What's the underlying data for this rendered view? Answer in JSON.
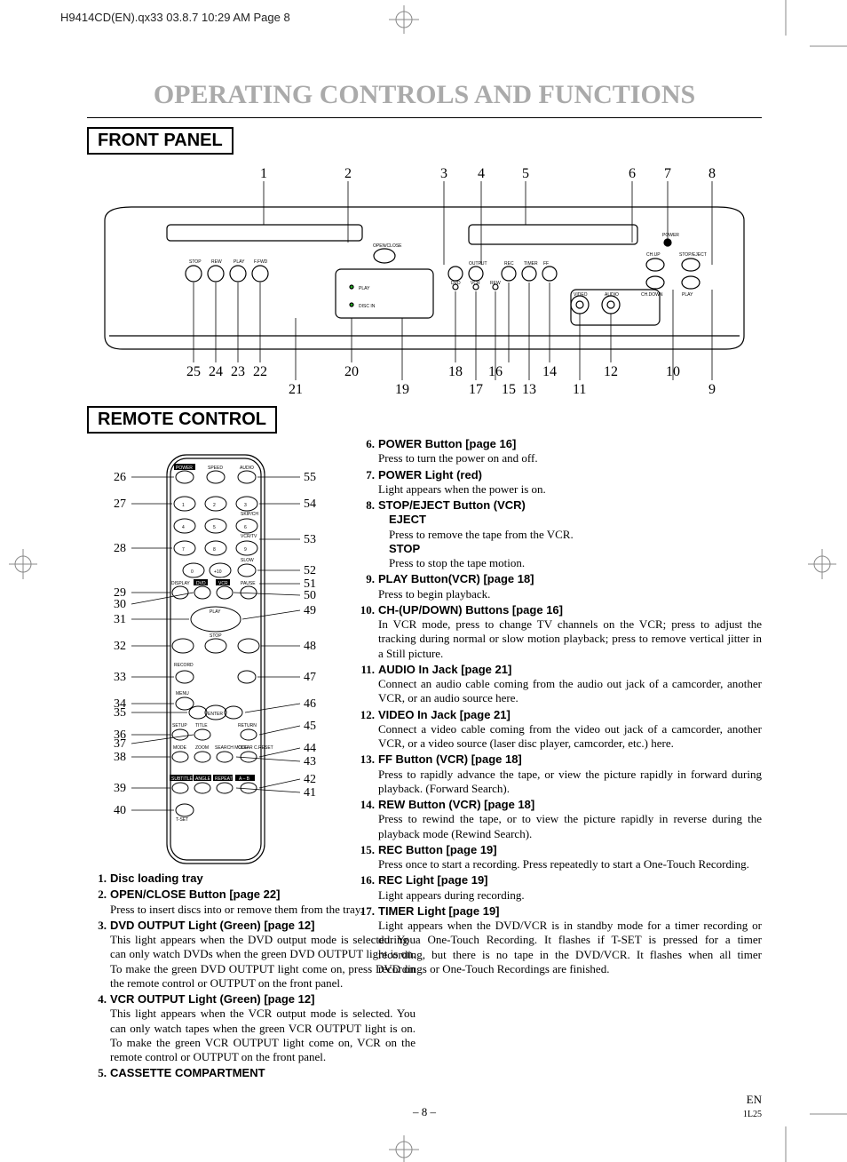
{
  "header_info": "H9414CD(EN).qx33  03.8.7 10:29 AM  Page 8",
  "main_title": "OPERATING CONTROLS AND FUNCTIONS",
  "section_front": "FRONT PANEL",
  "section_remote": "REMOTE CONTROL",
  "front_callouts_top": [
    "1",
    "2",
    "3",
    "4",
    "5",
    "6",
    "7",
    "8"
  ],
  "front_callouts_bottom": [
    "25",
    "24",
    "23",
    "22",
    "20",
    "18",
    "16",
    "14",
    "12",
    "10",
    "21",
    "19",
    "17",
    "15",
    "13",
    "11",
    "9"
  ],
  "remote_left": [
    "26",
    "27",
    "28",
    "29",
    "30",
    "31",
    "32",
    "33",
    "34",
    "35",
    "36",
    "37",
    "38",
    "39",
    "40"
  ],
  "remote_right": [
    "55",
    "54",
    "53",
    "52",
    "51",
    "50",
    "49",
    "48",
    "47",
    "46",
    "45",
    "44",
    "43",
    "42",
    "41"
  ],
  "remote_labels": {
    "power": "POWER",
    "speed": "SPEED",
    "audio": "AUDIO",
    "skipch": "SKIP/CH",
    "vcrtv": "VCR/TV",
    "slow": "SLOW",
    "display": "DISPLAY",
    "dvd": "DVD",
    "vcr": "VCR",
    "pause": "PAUSE",
    "play": "PLAY",
    "stop": "STOP",
    "record": "RECORD",
    "menu": "MENU",
    "enter": "ENTER",
    "setup": "SETUP",
    "title": "TITLE",
    "return": "RETURN",
    "mode": "MODE",
    "zoom": "ZOOM",
    "search": "SEARCH MODE",
    "clear": "CLEAR C.RESET",
    "subtitle": "SUBTITLE",
    "angle": "ANGLE",
    "repeat": "REPEAT",
    "ab": "A – B",
    "tset": "T-SET",
    "n1": "1",
    "n2": "2",
    "n3": "3",
    "n4": "4",
    "n5": "5",
    "n6": "6",
    "n7": "7",
    "n8": "8",
    "n9": "9",
    "n0": "0",
    "n10": "+10"
  },
  "front_labels": {
    "openclose": "OPEN/CLOSE",
    "play": "PLAY",
    "discin": "DISC IN",
    "power": "POWER",
    "chup": "CH.UP",
    "stopej": "STOP/EJECT",
    "video": "VIDEO",
    "audio": "AUDIO",
    "chdown": "CH.DOWN",
    "playr": "PLAY",
    "output": "OUTPUT",
    "rec": "REC",
    "timer": "TIMER",
    "ff": "FF",
    "rew": "REW",
    "dvd": "DVD",
    "vcr": "VCR",
    "stop": "STOP",
    "play2": "PLAY",
    "ffwd": "F.FWD"
  },
  "items_left": [
    {
      "n": "1.",
      "title": "Disc loading tray",
      "desc": ""
    },
    {
      "n": "2.",
      "title": "OPEN/CLOSE Button [page 22]",
      "desc": "Press to insert discs into or remove them from the tray."
    },
    {
      "n": "3.",
      "title": "DVD OUTPUT Light (Green) [page 12]",
      "desc": "This light appears when the DVD output mode is selected. You can only watch DVDs when the green DVD OUTPUT light is on. To make the green DVD OUTPUT light come on, press DVD on the remote control or OUTPUT on the front panel."
    },
    {
      "n": "4.",
      "title": "VCR OUTPUT Light (Green) [page 12]",
      "desc": "This light appears when the VCR output mode is selected. You can only watch tapes when the green VCR OUTPUT light is on. To make the green VCR OUTPUT light come on, VCR on the remote control or OUTPUT on the front panel."
    },
    {
      "n": "5.",
      "title": "CASSETTE COMPARTMENT",
      "desc": ""
    }
  ],
  "items_right": [
    {
      "n": "6.",
      "title": "POWER Button [page 16]",
      "desc": "Press to turn the power on and off."
    },
    {
      "n": "7.",
      "title": "POWER Light (red)",
      "desc": "Light appears when the power is on."
    },
    {
      "n": "8.",
      "title": "STOP/EJECT Button (VCR)",
      "sub1": "EJECT",
      "desc1": "Press to remove the tape from the VCR.",
      "sub2": "STOP",
      "desc2": "Press to stop the tape motion."
    },
    {
      "n": "9.",
      "title": "PLAY Button(VCR) [page 18]",
      "desc": "Press to begin playback."
    },
    {
      "n": "10.",
      "title": "CH-(UP/DOWN) Buttons [page 16]",
      "desc": "In VCR mode, press to change TV channels on the VCR; press to adjust the tracking during normal or slow motion playback; press to remove vertical jitter in a Still picture."
    },
    {
      "n": "11.",
      "title": "AUDIO In Jack [page 21]",
      "desc": "Connect an audio cable coming from the audio out jack of a camcorder, another VCR, or an audio source here."
    },
    {
      "n": "12.",
      "title": "VIDEO In Jack [page 21]",
      "desc": "Connect a video cable coming from the video out jack of a camcorder, another VCR, or a video source (laser disc player, camcorder, etc.) here."
    },
    {
      "n": "13.",
      "title": "FF Button (VCR) [page 18]",
      "desc": "Press to rapidly advance the tape, or view the picture rapidly in forward during playback. (Forward Search)."
    },
    {
      "n": "14.",
      "title": "REW Button (VCR) [page 18]",
      "desc": "Press to rewind the tape, or to view the picture rapidly in reverse during the playback mode (Rewind Search)."
    },
    {
      "n": "15.",
      "title": "REC Button [page 19]",
      "desc": "Press once to start a recording. Press repeatedly to start a One-Touch Recording."
    },
    {
      "n": "16.",
      "title": "REC Light [page 19]",
      "desc": "Light appears during recording."
    },
    {
      "n": "17.",
      "title": "TIMER Light [page 19]",
      "desc": "Light appears when the DVD/VCR is in standby mode for a timer recording or during a One-Touch Recording. It flashes if T-SET is pressed for a timer recording, but there is no tape in the DVD/VCR. It flashes when all timer recordings or One-Touch Recordings are finished."
    }
  ],
  "page_number": "– 8 –",
  "footer_code1": "EN",
  "footer_code2": "1L25"
}
